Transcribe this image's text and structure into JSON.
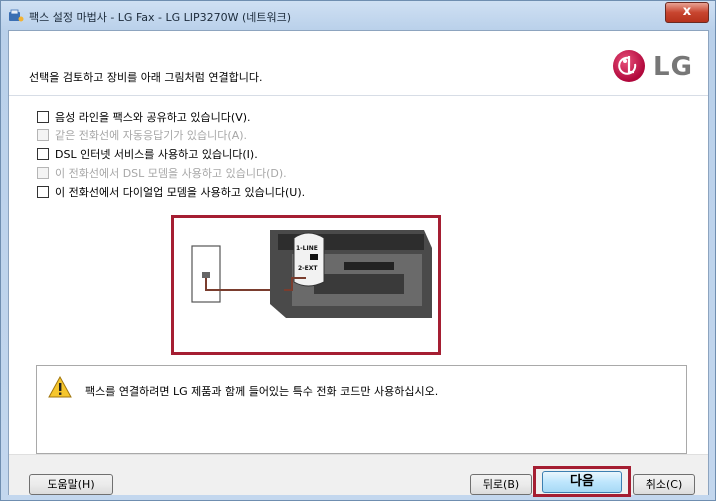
{
  "window": {
    "title": "팩스 설정 마법사 - LG Fax - LG LIP3270W (네트워크)",
    "close_label": "x"
  },
  "header": {
    "instruction": "선택을 검토하고 장비를 아래 그림처럼 연결합니다.",
    "logo_text": "LG"
  },
  "options": [
    {
      "label": "음성 라인을 팩스와 공유하고 있습니다(V).",
      "enabled": true,
      "checked": false
    },
    {
      "label": "같은 전화선에 자동응답기가 있습니다(A).",
      "enabled": false,
      "checked": false
    },
    {
      "label": "DSL 인터넷 서비스를 사용하고 있습니다(I).",
      "enabled": true,
      "checked": false
    },
    {
      "label": "이 전화선에서 DSL 모뎀을 사용하고 있습니다(D).",
      "enabled": false,
      "checked": false
    },
    {
      "label": "이 전화선에서 다이얼업 모뎀을 사용하고 있습니다(U).",
      "enabled": true,
      "checked": false
    }
  ],
  "diagram": {
    "port_1": "1-LINE",
    "port_2": "2-EXT"
  },
  "info": {
    "message": "팩스를 연결하려면 LG 제품과 함께 들어있는 특수 전화 코드만 사용하십시오."
  },
  "buttons": {
    "help": "도움말(H)",
    "back": "뒤로(B)",
    "next": "다음",
    "cancel": "취소(C)"
  },
  "colors": {
    "highlight": "#a51e32",
    "lg_brand": "#b0073b"
  }
}
